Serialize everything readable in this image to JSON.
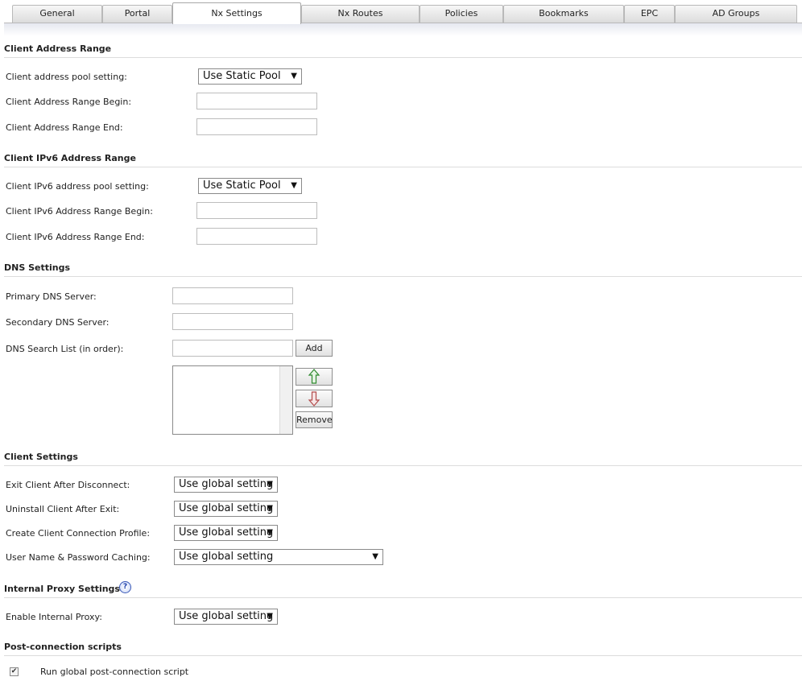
{
  "tabs": [
    "General",
    "Portal",
    "Nx Settings",
    "Nx Routes",
    "Policies",
    "Bookmarks",
    "EPC",
    "AD Groups"
  ],
  "active_tab": "Nx Settings",
  "client_address_range": {
    "title": "Client Address Range",
    "pool_label": "Client address pool setting:",
    "pool_value": "Use Static Pool",
    "begin_label": "Client Address Range Begin:",
    "begin_value": "",
    "end_label": "Client Address Range End:",
    "end_value": ""
  },
  "client_ipv6_range": {
    "title": "Client IPv6 Address Range",
    "pool_label": "Client IPv6 address pool setting:",
    "pool_value": "Use Static Pool",
    "begin_label": "Client IPv6 Address Range Begin:",
    "begin_value": "",
    "end_label": "Client IPv6 Address Range End:",
    "end_value": ""
  },
  "dns_settings": {
    "title": "DNS Settings",
    "primary_label": "Primary DNS Server:",
    "primary_value": "",
    "secondary_label": "Secondary DNS Server:",
    "secondary_value": "",
    "search_label": "DNS Search List (in order):",
    "search_value": "",
    "add_label": "Add",
    "remove_label": "Remove",
    "up_icon": "up-arrow-icon",
    "down_icon": "down-arrow-icon"
  },
  "client_settings": {
    "title": "Client Settings",
    "exit_label": "Exit Client After Disconnect:",
    "exit_value": "Use global setting",
    "uninstall_label": "Uninstall Client After Exit:",
    "uninstall_value": "Use global setting",
    "profile_label": "Create Client Connection Profile:",
    "profile_value": "Use global setting",
    "caching_label": "User Name & Password Caching:",
    "caching_value": "Use global setting"
  },
  "internal_proxy": {
    "title": "Internal Proxy Settings",
    "help_icon": "help-icon",
    "help_glyph": "?",
    "enable_label": "Enable Internal Proxy:",
    "enable_value": "Use global setting"
  },
  "post_connection": {
    "title": "Post-connection scripts",
    "run_label": "Run global post-connection script",
    "run_checked": true,
    "check_glyph": "✔"
  },
  "colors": {
    "up_arrow": "#2f8a2f",
    "down_arrow": "#b24b4b",
    "help": "#3a59b7"
  }
}
